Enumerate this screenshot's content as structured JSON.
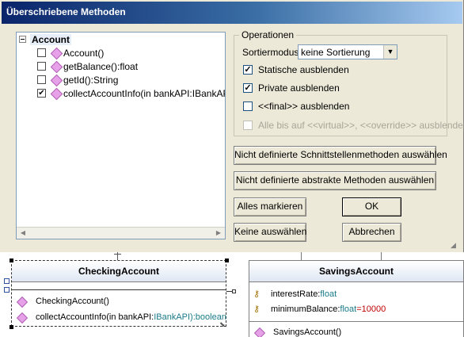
{
  "dialog": {
    "title": "Überschriebene Methoden",
    "tree": {
      "root": "Account",
      "items": [
        {
          "label": "Account()",
          "checked": false
        },
        {
          "label": "getBalance():float",
          "checked": false
        },
        {
          "label": "getId():String",
          "checked": false
        },
        {
          "label": "collectAccountInfo(in bankAPI:IBankAPI):bo",
          "checked": true
        }
      ]
    },
    "operations": {
      "group_title": "Operationen",
      "sort_label": "Sortiermodus:",
      "sort_value": "keine Sortierung",
      "options": [
        {
          "label": "Statische ausblenden",
          "checked": true,
          "enabled": true
        },
        {
          "label": "Private ausblenden",
          "checked": true,
          "enabled": true
        },
        {
          "label": "<<final>> ausblenden",
          "checked": false,
          "enabled": true
        },
        {
          "label": "Alle bis auf <<virtual>>, <<override>> ausblenden",
          "checked": false,
          "enabled": false
        }
      ]
    },
    "buttons": {
      "select_interface": "Nicht definierte Schnittstellenmethoden auswählen",
      "select_abstract": "Nicht definierte abstrakte Methoden auswählen",
      "mark_all": "Alles markieren",
      "ok": "OK",
      "select_none": "Keine auswählen",
      "cancel": "Abbrechen"
    }
  },
  "diagram": {
    "checking": {
      "name": "CheckingAccount",
      "methods": [
        {
          "prefix": "CheckingAccount()",
          "type": ""
        },
        {
          "prefix": "collectAccountInfo(in bankAPI:",
          "type": "IBankAPI):boolean"
        }
      ]
    },
    "savings": {
      "name": "SavingsAccount",
      "attributes": [
        {
          "name": "interestRate:",
          "type": "float",
          "value": ""
        },
        {
          "name": "minimumBalance:",
          "type": "float",
          "value": "=10000"
        }
      ],
      "methods": [
        {
          "label": "SavingsAccount()"
        }
      ]
    }
  },
  "colors": {
    "titlebar_start": "#0a246a",
    "titlebar_end": "#a6caf0",
    "dialog_bg": "#ece9d8",
    "type_color": "#1a7a8a",
    "value_color": "#c00000"
  }
}
